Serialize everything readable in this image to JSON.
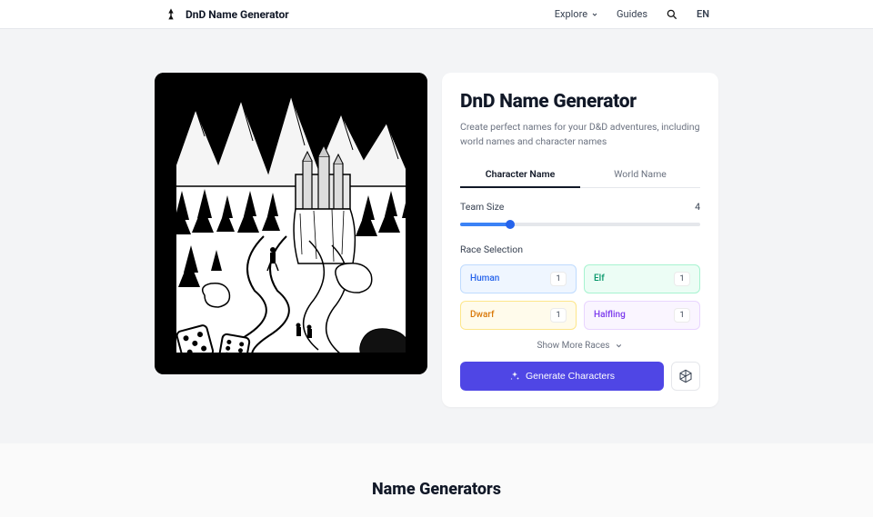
{
  "header": {
    "brand": "DnD Name Generator",
    "nav": {
      "explore": "Explore",
      "guides": "Guides",
      "lang": "EN"
    }
  },
  "panel": {
    "title": "DnD Name Generator",
    "subtitle": "Create perfect names for your D&D adventures, including world names and character names",
    "tabs": {
      "character": "Character Name",
      "world": "World Name"
    },
    "teamSize": {
      "label": "Team Size",
      "value": "4"
    },
    "raceLabel": "Race Selection",
    "races": [
      {
        "name": "Human",
        "count": "1"
      },
      {
        "name": "Elf",
        "count": "1"
      },
      {
        "name": "Dwarf",
        "count": "1"
      },
      {
        "name": "Halfling",
        "count": "1"
      }
    ],
    "showMore": "Show More Races",
    "generate": "Generate Characters"
  },
  "section2": {
    "title": "Name Generators"
  }
}
